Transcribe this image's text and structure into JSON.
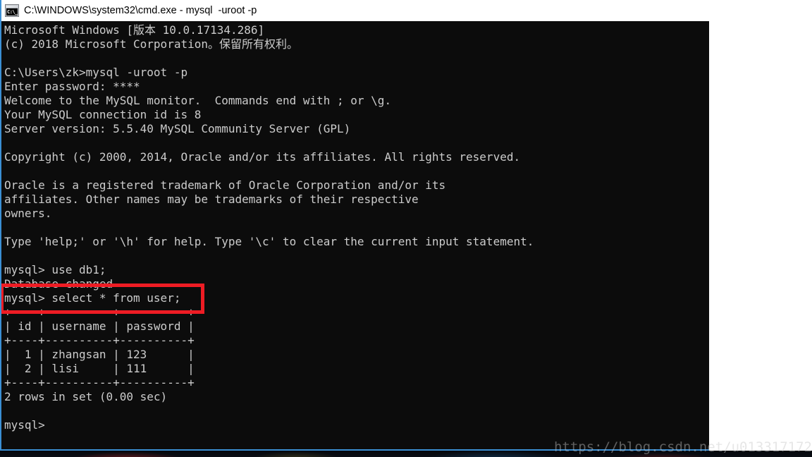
{
  "window": {
    "title": "C:\\WINDOWS\\system32\\cmd.exe - mysql  -uroot -p",
    "icon": "cmd-console-icon",
    "icon_glyph": "C:\\_",
    "border_color": "#3b8fd4",
    "titlebar_bg": "#ffffff"
  },
  "console": {
    "background_color": "#0c0c0c",
    "text_color": "#cccccc",
    "lines": [
      "Microsoft Windows [版本 10.0.17134.286]",
      "(c) 2018 Microsoft Corporation。保留所有权利。",
      "",
      "C:\\Users\\zk>mysql -uroot -p",
      "Enter password: ****",
      "Welcome to the MySQL monitor.  Commands end with ; or \\g.",
      "Your MySQL connection id is 8",
      "Server version: 5.5.40 MySQL Community Server (GPL)",
      "",
      "Copyright (c) 2000, 2014, Oracle and/or its affiliates. All rights reserved.",
      "",
      "Oracle is a registered trademark of Oracle Corporation and/or its",
      "affiliates. Other names may be trademarks of their respective",
      "owners.",
      "",
      "Type 'help;' or '\\h' for help. Type '\\c' to clear the current input statement.",
      "",
      "mysql> use db1;",
      "Database changed",
      "mysql> select * from user;",
      "+----+----------+----------+",
      "| id | username | password |",
      "+----+----------+----------+",
      "|  1 | zhangsan | 123      |",
      "|  2 | lisi     | 111      |",
      "+----+----------+----------+",
      "2 rows in set (0.00 sec)",
      "",
      "mysql>"
    ],
    "prompt_symbol": "mysql>",
    "shell_prompt": "C:\\Users\\zk>",
    "commands": [
      "mysql -uroot -p",
      "use db1;",
      "select * from user;"
    ],
    "password_masked": "****",
    "connection_id": "8",
    "server_version": "5.5.40 MySQL Community Server (GPL)",
    "database": "db1",
    "status_messages": [
      "Database changed",
      "2 rows in set (0.00 sec)"
    ]
  },
  "result_table": {
    "columns": [
      "id",
      "username",
      "password"
    ],
    "rows": [
      [
        "1",
        "zhangsan",
        "123"
      ],
      [
        "2",
        "lisi",
        "111"
      ]
    ],
    "row_count_text": "2 rows in set (0.00 sec)"
  },
  "annotation": {
    "type": "red-rectangle-highlight",
    "color": "#ee1c24",
    "highlighted_text": "mysql> select * from user;"
  },
  "watermark": {
    "text": "https://blog.csdn.net/u013317172"
  }
}
